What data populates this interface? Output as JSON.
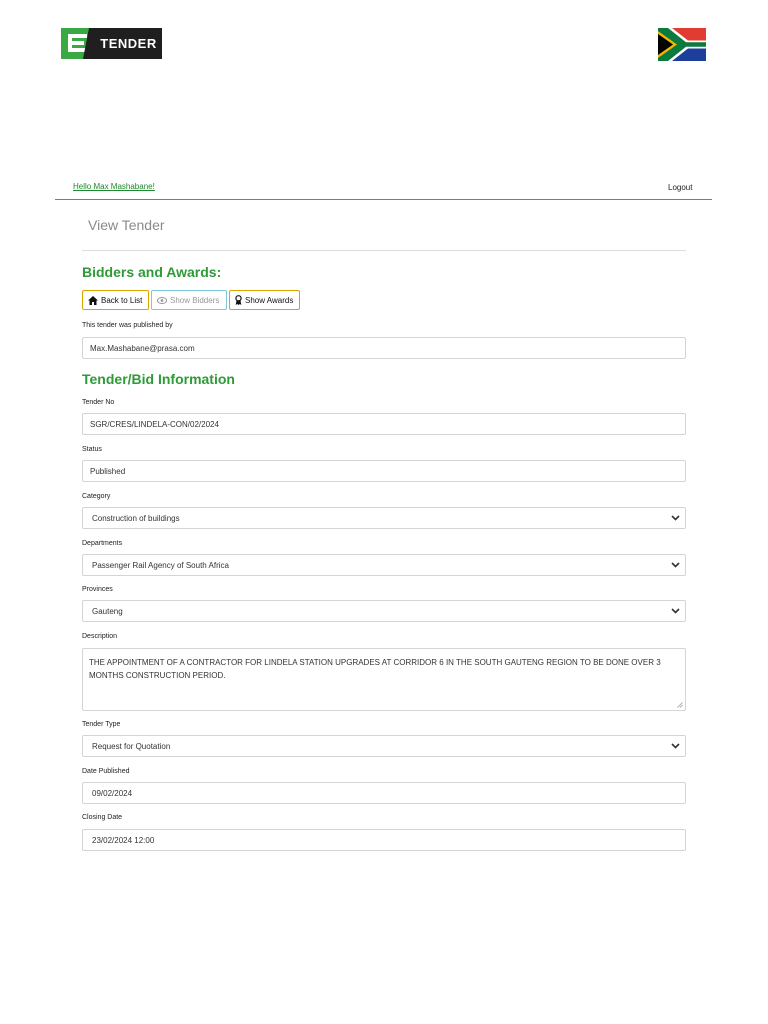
{
  "header": {
    "logo_text": "TENDER",
    "greeting": "Hello Max Mashabane!",
    "logout": "Logout"
  },
  "page": {
    "title": "View Tender"
  },
  "bidders_section": {
    "heading": "Bidders and Awards:",
    "buttons": {
      "back": "Back to List",
      "show_bidders": "Show Bidders",
      "show_awards": "Show Awards"
    },
    "published_by_label": "This tender was published by",
    "published_by_value": "Max.Mashabane@prasa.com"
  },
  "info_section": {
    "heading": "Tender/Bid Information",
    "tender_no": {
      "label": "Tender No",
      "value": "SGR/CRES/LINDELA-CON/02/2024"
    },
    "status": {
      "label": "Status",
      "value": "Published"
    },
    "category": {
      "label": "Category",
      "value": "Construction of buildings"
    },
    "departments": {
      "label": "Departments",
      "value": "Passenger Rail Agency of South Africa"
    },
    "provinces": {
      "label": "Provinces",
      "value": "Gauteng"
    },
    "description": {
      "label": "Description",
      "value": "THE APPOINTMENT OF A CONTRACTOR FOR LINDELA STATION UPGRADES AT CORRIDOR 6 IN THE SOUTH GAUTENG REGION TO BE DONE OVER 3 MONTHS CONSTRUCTION PERIOD."
    },
    "tender_type": {
      "label": "Tender Type",
      "value": "Request for Quotation"
    },
    "date_published": {
      "label": "Date Published",
      "value": "09/02/2024"
    },
    "closing_date": {
      "label": "Closing Date",
      "value": "23/02/2024 12:00"
    }
  },
  "colors": {
    "brand_green": "#2e9a38",
    "button_border": "#d9a400",
    "disabled_border": "#7fc8d8"
  },
  "icons": [
    "home-icon",
    "eye-icon",
    "award-icon",
    "chevron-down-icon",
    "flag-icon"
  ]
}
